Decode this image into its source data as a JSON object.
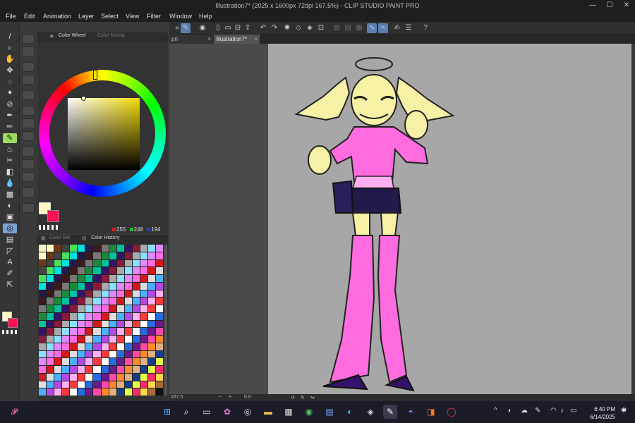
{
  "window": {
    "title": "Illustration7* (2025 x 1600px 72dpi 167.5%) - CLIP STUDIO PAINT PRO",
    "minimize_glyph": "—",
    "maximize_glyph": "☐",
    "close_glyph": "✕"
  },
  "menu": [
    "File",
    "Edit",
    "Animation",
    "Layer",
    "Select",
    "View",
    "Filter",
    "Window",
    "Help"
  ],
  "tabs": [
    {
      "label": "pri",
      "close": "×",
      "active": false
    },
    {
      "label": "Illustration7*",
      "close": "×",
      "active": true
    }
  ],
  "color_panel": {
    "tabs": [
      "Color Wheel",
      "Color Mixing"
    ],
    "main_color": "#fff8c2",
    "sub_color": "#ff1155",
    "rgb": {
      "r": "255",
      "g": "248",
      "b": "194"
    }
  },
  "color_set_panel": {
    "tabs": [
      "Color Set",
      "Color History"
    ]
  },
  "status": {
    "zoom": "167.5",
    "angle": "0.0"
  },
  "taskbar": {
    "time": "6:40 PM",
    "date": "6/14/2025"
  },
  "icons": [
    "brush-icon",
    "zoom-icon",
    "hand-icon",
    "move-icon",
    "lasso-icon",
    "magic-wand-icon",
    "eyedropper-icon",
    "pen-icon",
    "pencil-icon",
    "brush-tool-icon",
    "airbrush-icon",
    "decoration-icon",
    "eraser-icon",
    "blend-icon",
    "fill-icon",
    "gradient-icon",
    "figure-icon",
    "frame-icon",
    "ruler-icon",
    "text-icon",
    "balloon-icon",
    "correct-line-icon"
  ]
}
